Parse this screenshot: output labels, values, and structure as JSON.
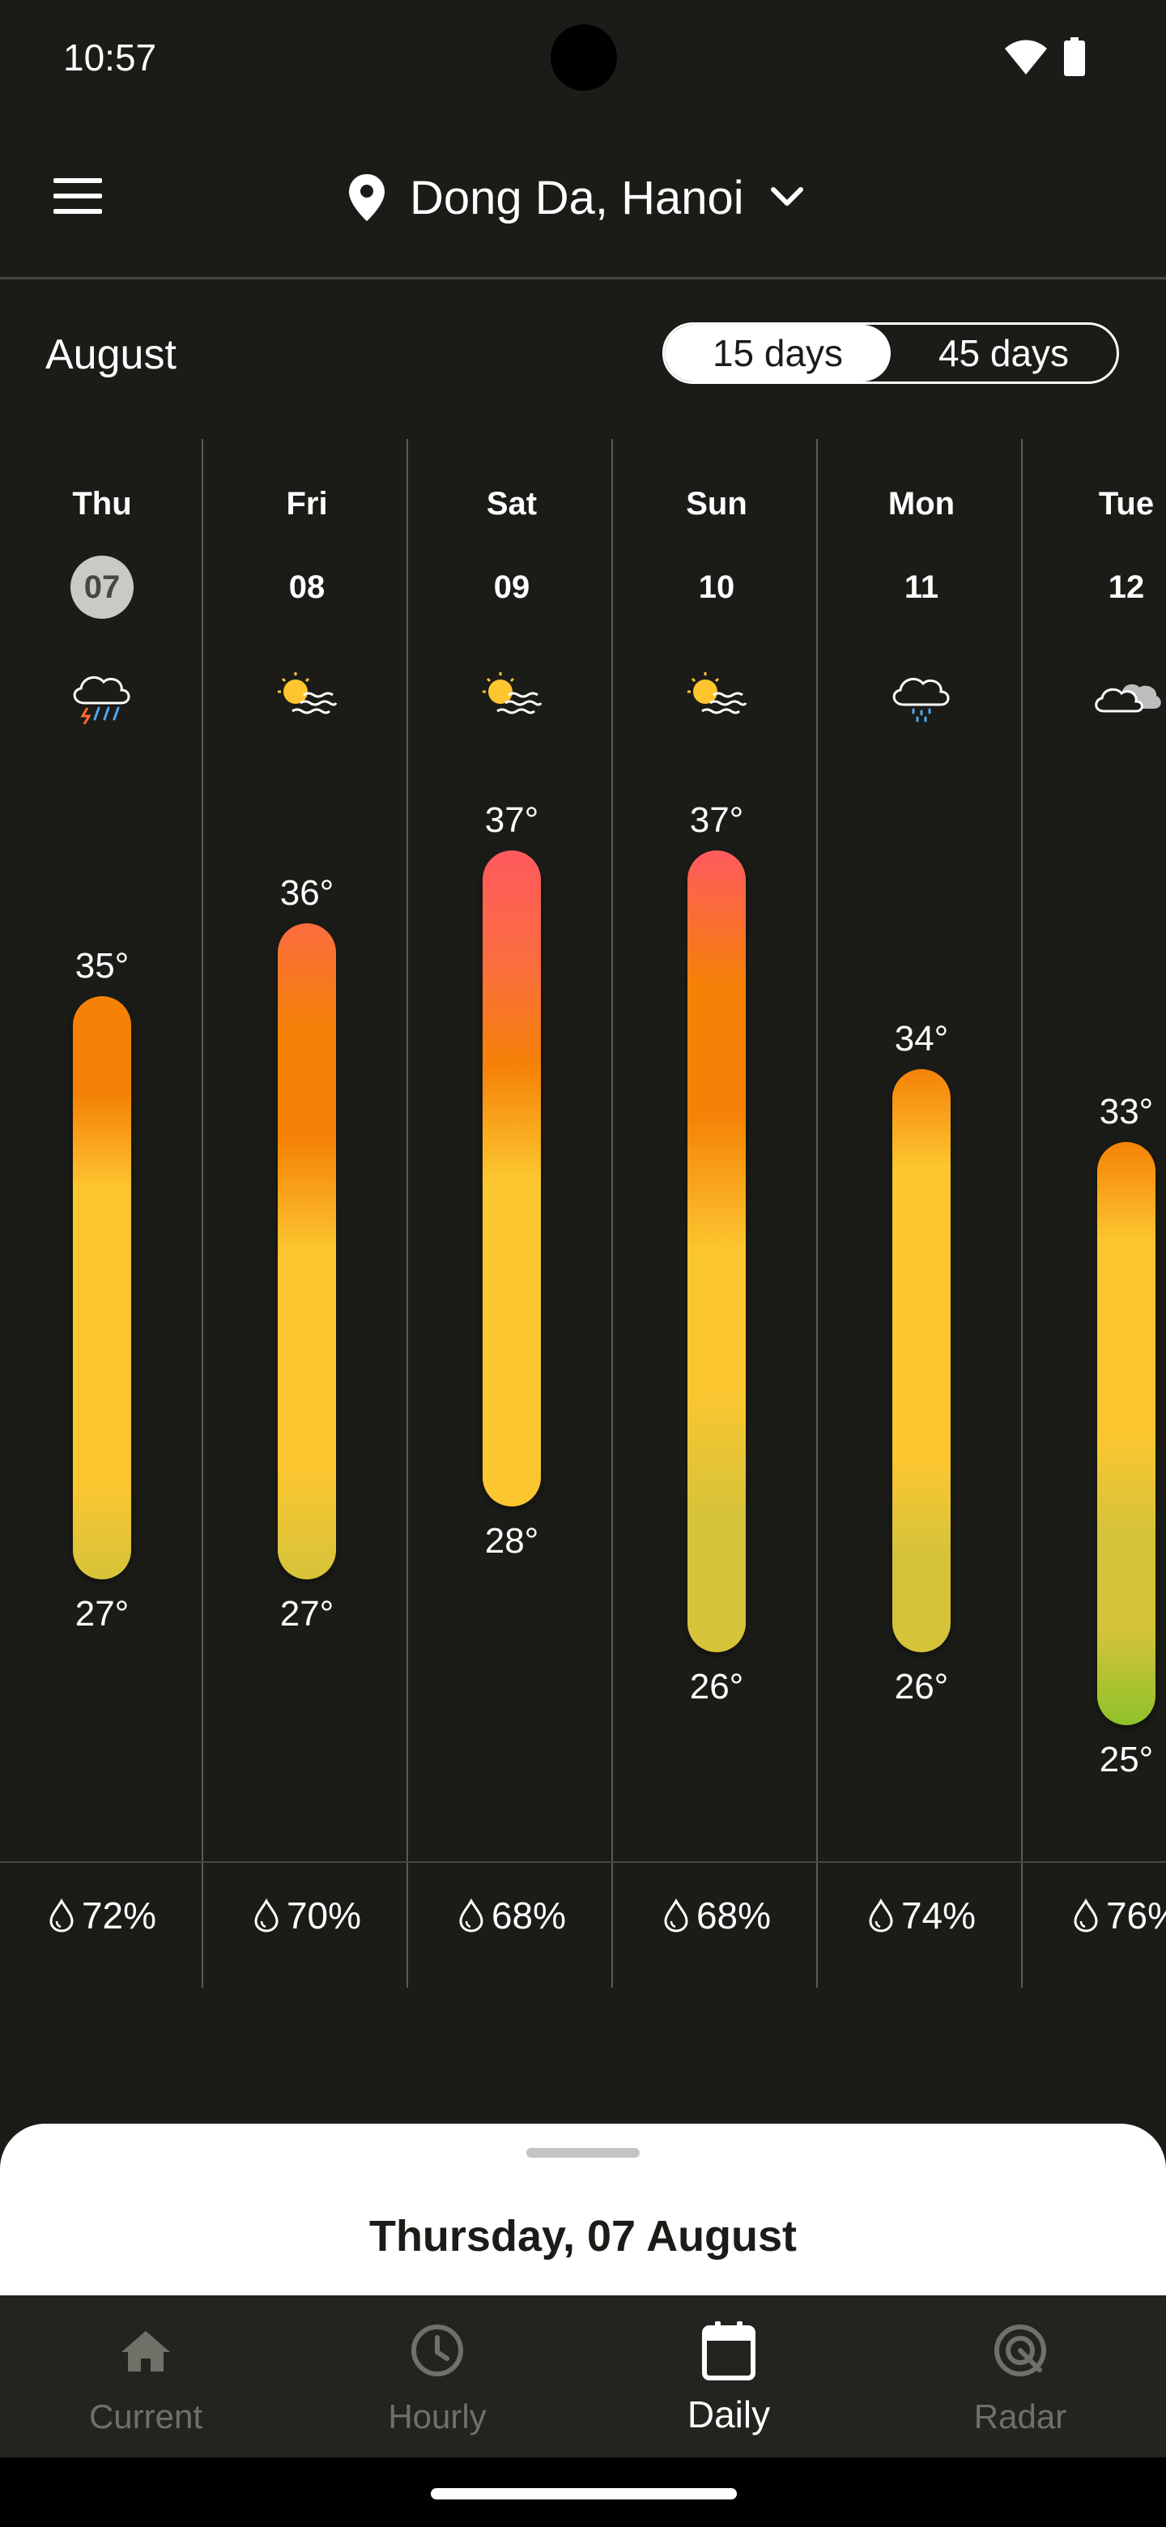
{
  "status_bar": {
    "time": "10:57"
  },
  "header": {
    "location": "Dong Da, Hanoi"
  },
  "month": "August",
  "range_toggle": {
    "options": [
      "15 days",
      "45 days"
    ],
    "selected": "15 days"
  },
  "days": [
    {
      "name": "Thu",
      "date": "07",
      "icon": "thunderstorm-rain-icon",
      "high": "35°",
      "low": "27°",
      "precip": "72%",
      "high_value": 35,
      "low_value": 27,
      "today": true
    },
    {
      "name": "Fri",
      "date": "08",
      "icon": "sun-haze-icon",
      "high": "36°",
      "low": "27°",
      "precip": "70%",
      "high_value": 36,
      "low_value": 27,
      "today": false
    },
    {
      "name": "Sat",
      "date": "09",
      "icon": "sun-haze-icon",
      "high": "37°",
      "low": "28°",
      "precip": "68%",
      "high_value": 37,
      "low_value": 28,
      "today": false
    },
    {
      "name": "Sun",
      "date": "10",
      "icon": "sun-haze-icon",
      "high": "37°",
      "low": "26°",
      "precip": "68%",
      "high_value": 37,
      "low_value": 26,
      "today": false
    },
    {
      "name": "Mon",
      "date": "11",
      "icon": "rain-cloud-icon",
      "high": "34°",
      "low": "26°",
      "precip": "74%",
      "high_value": 34,
      "low_value": 26,
      "today": false
    },
    {
      "name": "Tue",
      "date": "12",
      "icon": "cloudy-icon",
      "high": "33°",
      "low": "25°",
      "precip": "76%",
      "high_value": 33,
      "low_value": 25,
      "today": false
    }
  ],
  "sheet": {
    "title": "Thursday, 07 August"
  },
  "nav": {
    "items": [
      {
        "label": "Current",
        "icon": "home-icon"
      },
      {
        "label": "Hourly",
        "icon": "clock-icon"
      },
      {
        "label": "Daily",
        "icon": "calendar-icon"
      },
      {
        "label": "Radar",
        "icon": "radar-icon"
      }
    ],
    "active": "Daily"
  }
}
